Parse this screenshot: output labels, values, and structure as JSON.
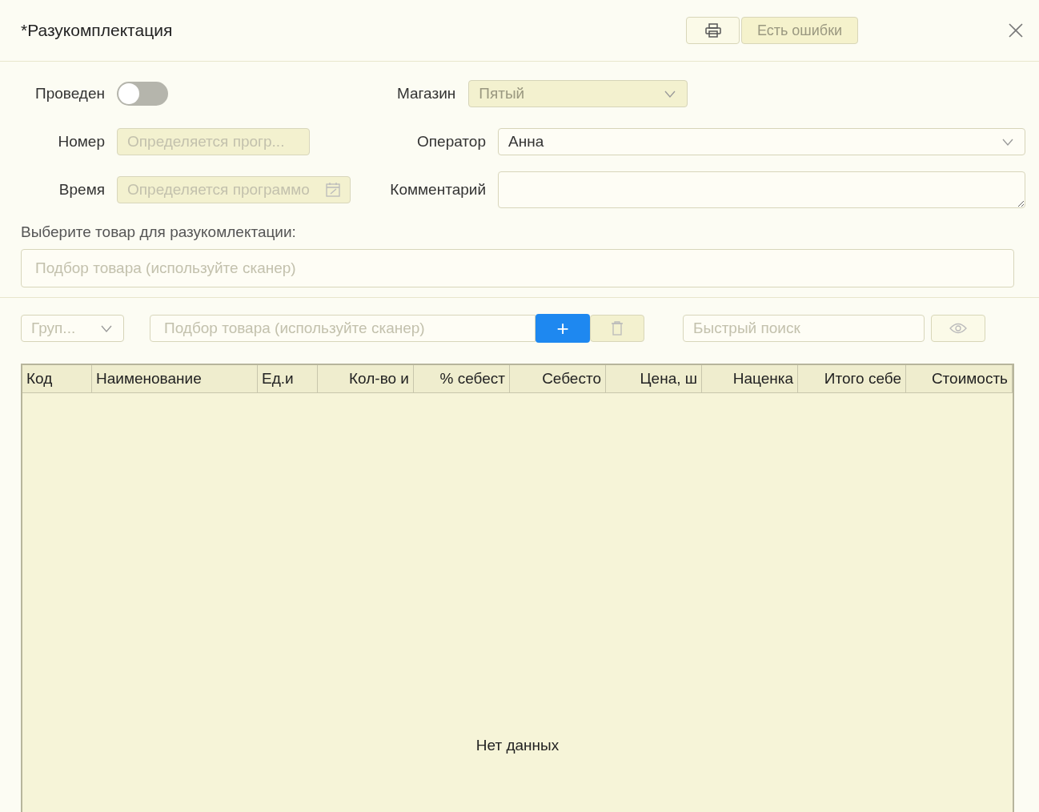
{
  "window": {
    "title": "*Разукомплектация",
    "errors_button": {
      "label": "Есть ошибки",
      "disabled": true
    }
  },
  "form": {
    "posted": {
      "label": "Проведен",
      "on": false
    },
    "store": {
      "label": "Магазин",
      "value": "Пятый",
      "disabled": true
    },
    "number": {
      "label": "Номер",
      "placeholder": "Определяется прогр...",
      "disabled": true
    },
    "operator": {
      "label": "Оператор",
      "value": "Анна",
      "disabled": false
    },
    "time": {
      "label": "Время",
      "placeholder": "Определяется программо",
      "disabled": true
    },
    "comment": {
      "label": "Комментарий"
    },
    "select_label": "Выберите товар для разукомлектации:",
    "product_field": {
      "placeholder": "Подбор товара (используйте сканер)"
    }
  },
  "toolbar": {
    "group": {
      "placeholder": "Груп..."
    },
    "product_field": {
      "placeholder": "Подбор товара (используйте сканер)"
    },
    "add_button": {
      "label": "+",
      "disabled": false
    },
    "delete_button": {
      "disabled": true
    },
    "search": {
      "placeholder": "Быстрый поиск"
    }
  },
  "table": {
    "columns": [
      {
        "label": "Код",
        "kind": "text"
      },
      {
        "label": "Наименование",
        "kind": "text"
      },
      {
        "label": "Ед.и",
        "kind": "text"
      },
      {
        "label": "Кол-во и",
        "kind": "number"
      },
      {
        "label": "% себест",
        "kind": "number"
      },
      {
        "label": "Себесто",
        "kind": "number"
      },
      {
        "label": "Цена, ш",
        "kind": "number"
      },
      {
        "label": "Наценка",
        "kind": "number"
      },
      {
        "label": "Итого себе",
        "kind": "number"
      },
      {
        "label": "Стоимость",
        "kind": "number"
      }
    ],
    "empty_text": "Нет данных"
  }
}
